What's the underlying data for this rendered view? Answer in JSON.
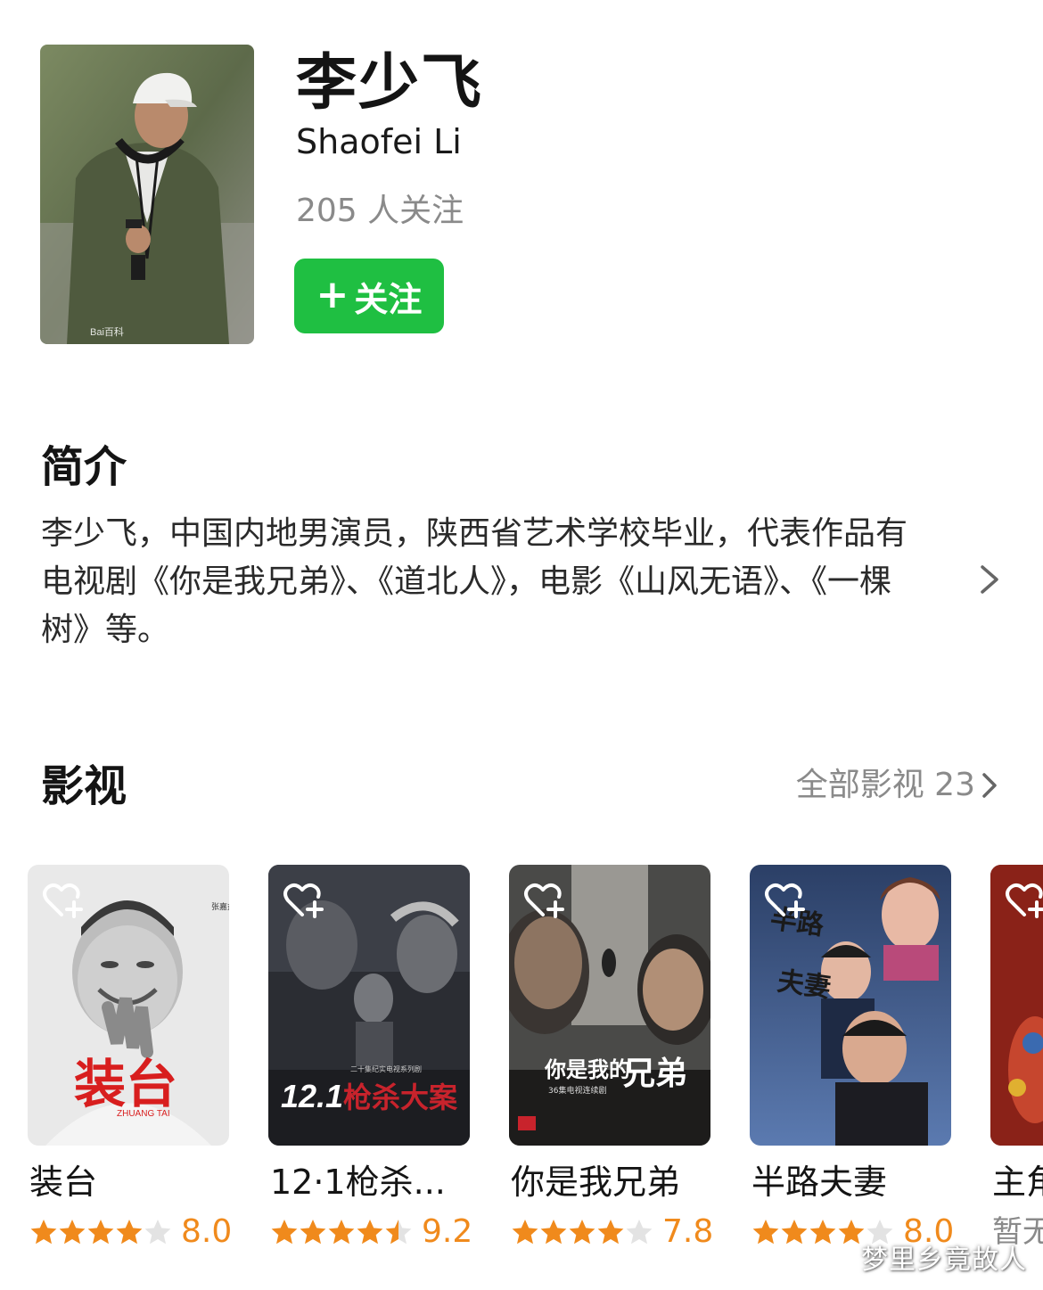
{
  "profile": {
    "name_cn": "李少飞",
    "name_en": "Shaofei Li",
    "followers": "205 人关注",
    "follow_label": "关注",
    "follow_plus": "+",
    "avatar_watermark": "Bai百科"
  },
  "intro": {
    "title": "简介",
    "text": "李少飞，中国内地男演员，陕西省艺术学校毕业，代表作品有电视剧《你是我兄弟》、《道北人》，电影《山风无语》、《一棵树》等。"
  },
  "films": {
    "title": "影视",
    "all_label": "全部影视 23",
    "items": [
      {
        "title": "装台",
        "score": "8.0",
        "stars": 4,
        "poster_text": "装台",
        "poster_sub": "ZHUANG TAI"
      },
      {
        "title": "12·1枪杀...",
        "score": "9.2",
        "stars": 4.5,
        "poster_text": "12.1枪杀大案",
        "poster_sub": "二十集纪实电视系列剧"
      },
      {
        "title": "你是我兄弟",
        "score": "7.8",
        "stars": 4,
        "poster_text": "你是我的兄弟",
        "poster_sub": "36集电视连续剧"
      },
      {
        "title": "半路夫妻",
        "score": "8.0",
        "stars": 4,
        "poster_text": "半路夫妻",
        "poster_sub": ""
      },
      {
        "title": "主角",
        "score": "",
        "stars": 0,
        "no_rating": "暂无",
        "poster_text": "",
        "poster_sub": ""
      }
    ]
  },
  "colors": {
    "accent_green": "#1fbf42",
    "star_orange": "#f08a1c",
    "star_empty": "#e3e3e3",
    "muted_text": "#8a8a8a"
  },
  "icons": {
    "fav": "heart-plus-icon",
    "chevron": "chevron-right-icon",
    "star": "star-icon"
  },
  "watermark": "梦里乡竟故人"
}
